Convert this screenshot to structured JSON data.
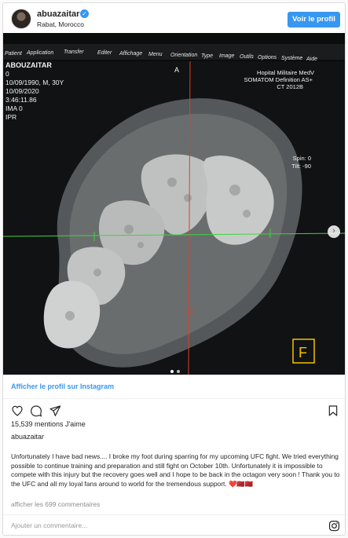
{
  "header": {
    "username": "abuazaitar",
    "location": "Rabat, Morocco",
    "follow_label": "Voir le profil"
  },
  "photo": {
    "menu_items": [
      "Patient",
      "Application",
      "Transfer",
      "Editer",
      "Affichage",
      "Menu",
      "Orientation",
      "Type",
      "Image",
      "Outils",
      "Options",
      "Système",
      "Aide"
    ],
    "patient_lines": [
      "ABOUZAITAR",
      "0",
      "10/09/1990, M, 30Y",
      "10/09/2020",
      "3:46:11.86",
      "IMA 0",
      "IPR"
    ],
    "hospital_lines": [
      "Hopital Militaire MedV",
      "SOMATOM Definition AS+",
      "CT 2012B"
    ],
    "orientation_label": "A",
    "spin": "Spin:  0",
    "tilt": "Tilt:  -90",
    "corner_letter": "F"
  },
  "footer": {
    "profile_link": "Afficher le profil sur Instagram",
    "likes": "15,539 mentions J'aime",
    "caption_user": "abuazaitar",
    "caption": "Unfortunately I have bad news.... I broke my foot during sparring for my upcoming UFC fight. We tried everything possible to continue training and preparation and still fight on October 10th. Unfortunately it is impossible to compete with this injury but the recovery goes well and I hope to be back in the octagon very soon ! Thank you to the UFC and all my loyal fans around to world for the tremendous support. ❤️🇲🇦🇲🇦",
    "comments_link": "afficher les 699 commentaires",
    "comment_placeholder": "Ajouter un commentaire..."
  },
  "colors": {
    "accent": "#3897f0",
    "crosshair_red": "#e0402a",
    "crosshair_green": "#3dd43d",
    "label_yellow": "#f2c200"
  },
  "icons": [
    "heart-icon",
    "comment-icon",
    "share-icon",
    "bookmark-icon",
    "instagram-icon",
    "verified-badge-icon",
    "chevron-right-icon"
  ]
}
